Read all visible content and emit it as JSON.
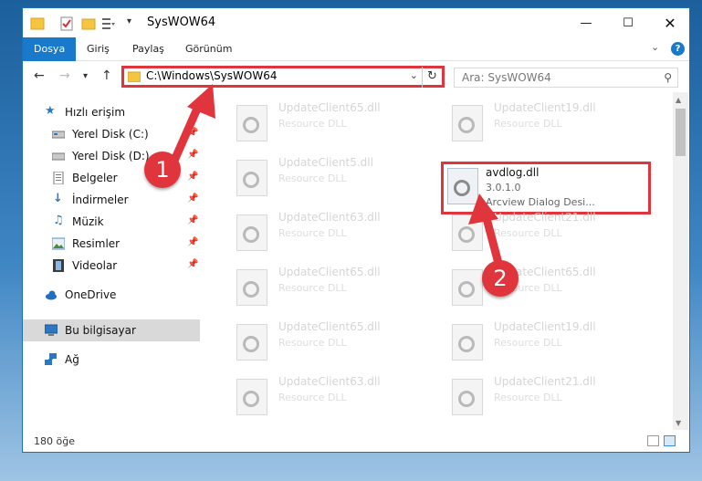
{
  "window": {
    "title": "SysWOW64"
  },
  "ribbon": {
    "tabs": [
      "Dosya",
      "Giriş",
      "Paylaş",
      "Görünüm"
    ]
  },
  "nav": {
    "address_path": "C:\\Windows\\SysWOW64",
    "search_placeholder": "Ara: SysWOW64"
  },
  "sidebar": {
    "items": [
      {
        "label": "Hızlı erişim",
        "icon": "star-icon",
        "pinned": false
      },
      {
        "label": "Yerel Disk (C:)",
        "icon": "drive-icon",
        "pinned": true
      },
      {
        "label": "Yerel Disk (D:)",
        "icon": "drive-icon",
        "pinned": true
      },
      {
        "label": "Belgeler",
        "icon": "documents-icon",
        "pinned": true
      },
      {
        "label": "İndirmeler",
        "icon": "download-icon",
        "pinned": true
      },
      {
        "label": "Müzik",
        "icon": "music-icon",
        "pinned": true
      },
      {
        "label": "Resimler",
        "icon": "pictures-icon",
        "pinned": true
      },
      {
        "label": "Videolar",
        "icon": "video-icon",
        "pinned": true
      },
      {
        "label": "OneDrive",
        "icon": "cloud-icon",
        "pinned": false
      },
      {
        "label": "Bu bilgisayar",
        "icon": "computer-icon",
        "pinned": false
      },
      {
        "label": "Ağ",
        "icon": "network-icon",
        "pinned": false
      }
    ]
  },
  "files": {
    "left_column": [
      {
        "name": "UpdateClient65.dll",
        "desc": "Resource DLL"
      },
      {
        "name": "UpdateClient5.dll",
        "desc": "Resource DLL"
      },
      {
        "name": "UpdateClient63.dll",
        "desc": "Resource DLL"
      },
      {
        "name": "UpdateClient65.dll",
        "desc": "Resource DLL"
      },
      {
        "name": "UpdateClient65.dll",
        "desc": "Resource DLL"
      },
      {
        "name": "UpdateClient63.dll",
        "desc": "Resource DLL"
      }
    ],
    "right_column": [
      {
        "name": "UpdateClient19.dll",
        "desc": "Resource DLL"
      },
      {
        "name": "UpdateClient21.dll",
        "desc": "Resource DLL"
      },
      {
        "name": "UpdateClient65.dll",
        "desc": "Resource DLL"
      },
      {
        "name": "UpdateClient19.dll",
        "desc": "Resource DLL"
      },
      {
        "name": "UpdateClient21.dll",
        "desc": "Resource DLL"
      }
    ],
    "highlighted": {
      "name": "avdlog.dll",
      "version": "3.0.1.0",
      "desc": "Arcview Dialog Desi..."
    }
  },
  "status": {
    "item_count": "180 öğe"
  },
  "annotations": {
    "step1": "1",
    "step2": "2",
    "color": "#e0353c"
  }
}
